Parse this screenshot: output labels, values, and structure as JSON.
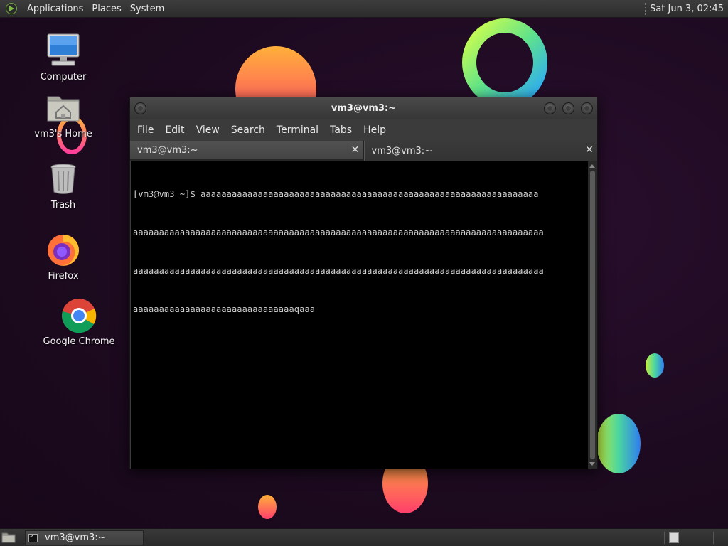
{
  "top_panel": {
    "menus": [
      "Applications",
      "Places",
      "System"
    ],
    "clock": "Sat Jun  3, 02:45"
  },
  "desktop": {
    "icons": [
      {
        "label": "Computer",
        "icon": "computer-icon"
      },
      {
        "label": "vm3's Home",
        "icon": "home-folder-icon"
      },
      {
        "label": "Trash",
        "icon": "trash-icon"
      },
      {
        "label": "Firefox",
        "icon": "firefox-icon"
      },
      {
        "label": "Google Chrome",
        "icon": "chrome-icon"
      }
    ]
  },
  "window": {
    "title": "vm3@vm3:~",
    "menus": [
      "File",
      "Edit",
      "View",
      "Search",
      "Terminal",
      "Tabs",
      "Help"
    ],
    "tabs": [
      {
        "label": "vm3@vm3:~",
        "active": true
      },
      {
        "label": "vm3@vm3:~",
        "active": false
      }
    ],
    "terminal_lines": [
      "[vm3@vm3 ~]$ aaaaaaaaaaaaaaaaaaaaaaaaaaaaaaaaaaaaaaaaaaaaaaaaaaaaaaaaaaaaaaaaa",
      "aaaaaaaaaaaaaaaaaaaaaaaaaaaaaaaaaaaaaaaaaaaaaaaaaaaaaaaaaaaaaaaaaaaaaaaaaaaaaaa",
      "aaaaaaaaaaaaaaaaaaaaaaaaaaaaaaaaaaaaaaaaaaaaaaaaaaaaaaaaaaaaaaaaaaaaaaaaaaaaaaa",
      "aaaaaaaaaaaaaaaaaaaaaaaaaaaaaaaqaaa"
    ]
  },
  "taskbar": {
    "tasks": [
      {
        "label": "vm3@vm3:~"
      }
    ]
  },
  "colors": {
    "wallpaper": "#1d0a20",
    "terminal_bg": "#000000",
    "terminal_fg": "#cfcfcf"
  }
}
